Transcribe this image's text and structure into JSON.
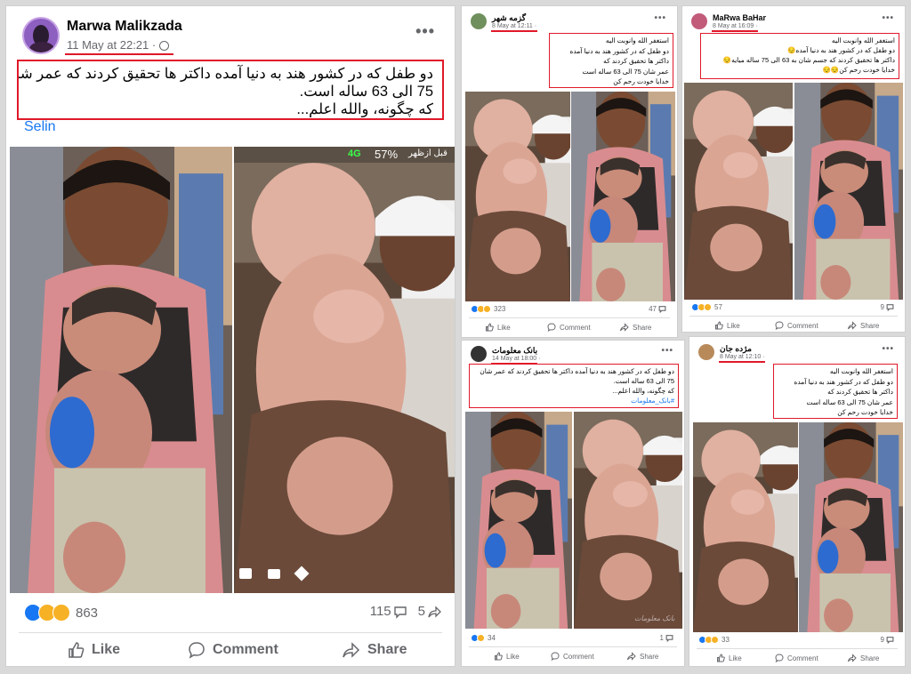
{
  "colors": {
    "highlight": "#e0192a",
    "fb_blue": "#1877f2",
    "meta_gray": "#65676b"
  },
  "main_post": {
    "author": "Marwa Malikzada",
    "date": "11 May at 22:21 · ",
    "text_line1": "دو طفل که در کشور هند به دنیا آمده داکتر ها تحقیق کردند که عمر شان",
    "text_line2": "75 الی 63 ساله است.",
    "text_line3": "که چگونه، والله اعلم...",
    "tag": "Selin",
    "status_bar_signal": "4G",
    "status_bar_battery": "57%",
    "status_bar_time": "قبل ازظهر",
    "reaction_count": "863",
    "comment_count": "115",
    "share_count": "5",
    "like_label": "Like",
    "comment_label": "Comment",
    "share_label": "Share"
  },
  "posts": [
    {
      "author": "گزمه شهر",
      "date": "8 May at 12:11 ·",
      "lines": [
        "استغفر الله وانوبت الیه",
        "دو طفل که در کشور هند به دنیا آمده",
        "داکتر ها تحقیق کردند که",
        "عمر شان 75 الی 63 ساله است",
        "خدایا خودت رحم کن"
      ],
      "reaction_count": "323",
      "comment_count": "47",
      "like_label": "Like",
      "comment_label": "Comment",
      "share_label": "Share"
    },
    {
      "author": "MaRwa BaHar",
      "date": "8 May at 16:09 ·",
      "lines": [
        "استغفر الله وانوبت الیه",
        "دو طفل که در کشور هند به دنیا آمده😔",
        "داکتر ها تحقیق کردند که جسم شان به 63 الی 75 ساله میایه😔",
        "خدایا خودت رحم کن😔😔"
      ],
      "reaction_count": "57",
      "comment_count": "9",
      "like_label": "Like",
      "comment_label": "Comment",
      "share_label": "Share"
    },
    {
      "author": "بانک معلومات",
      "date": "14 May at 18:00 ·",
      "lines": [
        "دو طفل که در کشور هند به دنیا آمده داکتر ها تحقیق کردند که عمر شان",
        "75 الی 63 ساله است.",
        "که چگونه، والله اعلم...",
        "#بانک_معلومات"
      ],
      "reaction_count": "34",
      "comment_count": "1",
      "watermark": "بانک معلومات",
      "like_label": "Like",
      "comment_label": "Comment",
      "share_label": "Share"
    },
    {
      "author": "مژده جان",
      "date": "8 May at 12:10 ·",
      "lines": [
        "استغفر الله وانوبت الیه",
        "دو طفل که در کشور هند به دنیا آمده",
        "داکتر ها تحقیق کردند که",
        "عمر شان 75 الی 63 ساله است",
        "خدایا خودت رحم کن"
      ],
      "reaction_count": "33",
      "comment_count": "9",
      "like_label": "Like",
      "comment_label": "Comment",
      "share_label": "Share"
    }
  ]
}
